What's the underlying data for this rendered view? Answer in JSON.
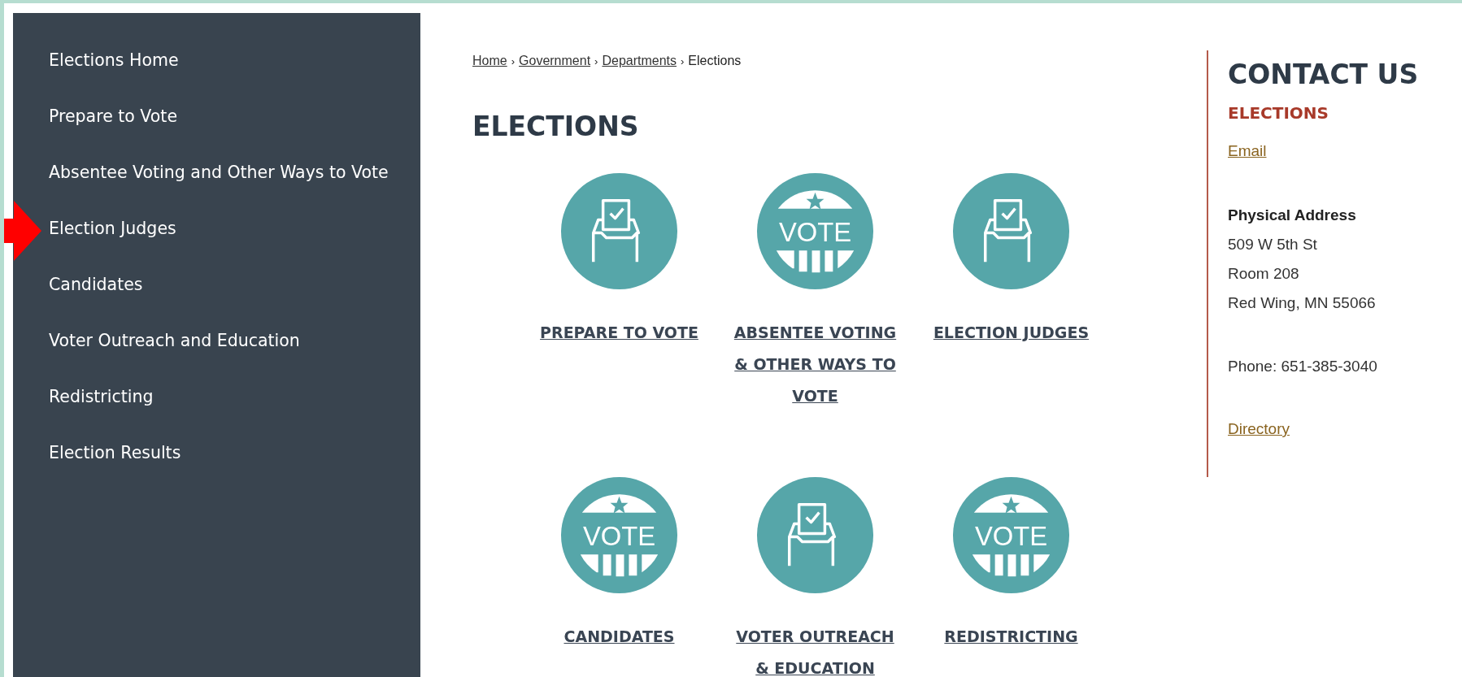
{
  "sidebar": {
    "items": [
      {
        "label": "Elections Home",
        "selected": false
      },
      {
        "label": "Prepare to Vote",
        "selected": false
      },
      {
        "label": "Absentee Voting and Other Ways to Vote",
        "selected": false
      },
      {
        "label": "Election Judges",
        "selected": false
      },
      {
        "label": "Candidates",
        "selected": false
      },
      {
        "label": "Voter Outreach and Education",
        "selected": false
      },
      {
        "label": "Redistricting",
        "selected": false
      },
      {
        "label": "Election Results",
        "selected": false
      }
    ]
  },
  "breadcrumb": {
    "separator": "›",
    "items": [
      {
        "label": "Home",
        "kind": "link"
      },
      {
        "label": "Government",
        "kind": "link"
      },
      {
        "label": "Departments",
        "kind": "link"
      },
      {
        "label": "Elections",
        "kind": "current"
      }
    ]
  },
  "heading": "ELECTIONS",
  "tiles": [
    {
      "label": "PREPARE TO VOTE",
      "kind": "ballot"
    },
    {
      "label": "ABSENTEE VOTING & OTHER WAYS TO VOTE",
      "kind": "vote",
      "icon_text": "VOTE"
    },
    {
      "label": "ELECTION JUDGES",
      "kind": "ballot"
    },
    {
      "label": "CANDIDATES",
      "kind": "vote",
      "icon_text": "VOTE"
    },
    {
      "label": "VOTER OUTREACH & EDUCATION",
      "kind": "ballot"
    },
    {
      "label": "REDISTRICTING",
      "kind": "vote",
      "icon_text": "VOTE"
    }
  ],
  "contact": {
    "title": "CONTACT US",
    "department": "ELECTIONS",
    "email": "Email",
    "address_label": "Physical Address",
    "address_lines": [
      "509 W 5th St",
      "Room 208",
      "Red Wing, MN 55066"
    ],
    "phone": "Phone: 651-385-3040",
    "directory": "Directory"
  }
}
